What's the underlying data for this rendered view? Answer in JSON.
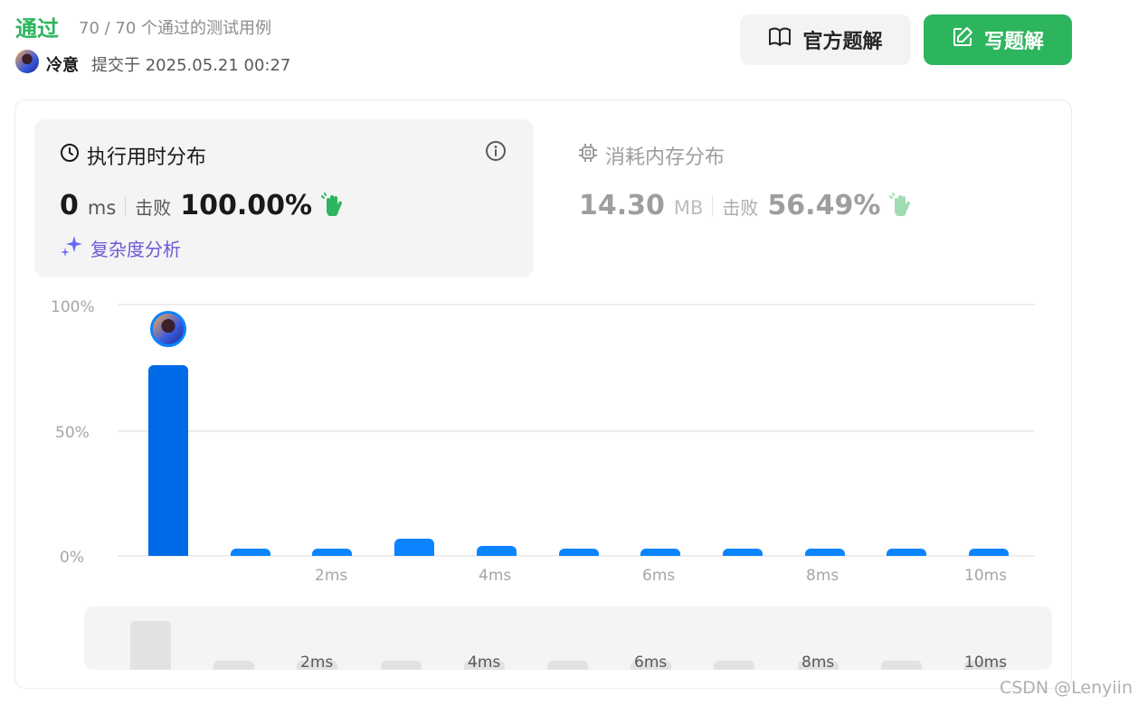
{
  "header": {
    "status": "通过",
    "testcases": "70 / 70 个通过的测试用例",
    "username": "冷意",
    "submitted_at": "提交于 2025.05.21 00:27"
  },
  "buttons": {
    "official_solution": "官方题解",
    "write_solution": "写题解"
  },
  "runtime": {
    "title": "执行用时分布",
    "value": "0",
    "unit": "ms",
    "beat_label": "击败",
    "beat_value": "100.00%",
    "complexity_link": "复杂度分析"
  },
  "memory": {
    "title": "消耗内存分布",
    "value": "14.30",
    "unit": "MB",
    "beat_label": "击败",
    "beat_value": "56.49%"
  },
  "colors": {
    "accent_green": "#2db55d",
    "bar_blue": "#0a84ff",
    "bar_selected": "#006ae6"
  },
  "chart_data": {
    "type": "bar",
    "categories": [
      "0ms",
      "1ms",
      "2ms",
      "3ms",
      "4ms",
      "5ms",
      "6ms",
      "7ms",
      "8ms",
      "9ms",
      "10ms"
    ],
    "values": [
      76,
      3,
      3,
      7,
      4,
      3,
      3,
      3,
      3,
      3,
      3
    ],
    "y_ticks": [
      "100%",
      "50%",
      "0%"
    ],
    "x_ticks": [
      "2ms",
      "4ms",
      "6ms",
      "8ms",
      "10ms"
    ],
    "ylim": [
      0,
      100
    ],
    "highlighted_category": "0ms",
    "grid": true
  },
  "minimap": {
    "x_ticks": [
      "2ms",
      "4ms",
      "6ms",
      "8ms",
      "10ms"
    ]
  },
  "watermark": "CSDN @Lenyiin"
}
